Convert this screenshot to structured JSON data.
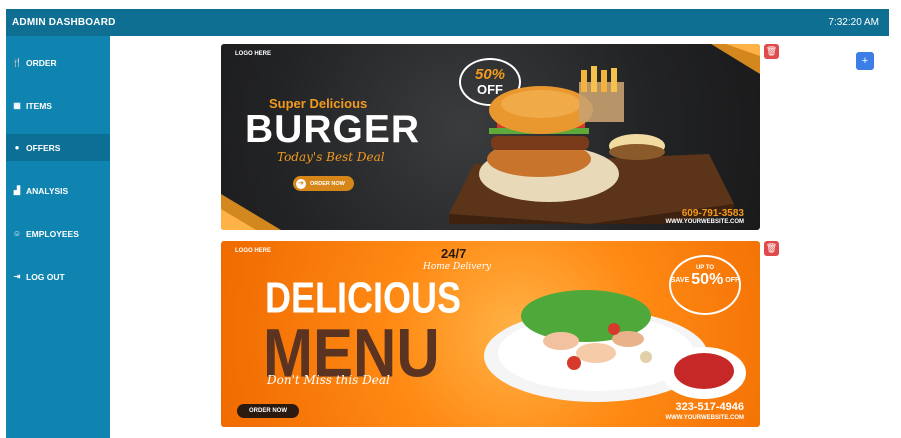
{
  "header": {
    "title": "ADMIN DASHBOARD",
    "clock": "7:32:20 AM"
  },
  "sidebar": {
    "items": [
      {
        "label": "ORDER",
        "icon": "utensils-icon",
        "glyph": "🍴"
      },
      {
        "label": "ITEMS",
        "icon": "items-icon",
        "glyph": "▦"
      },
      {
        "label": "OFFERS",
        "icon": "offer-icon",
        "glyph": "●"
      },
      {
        "label": "ANALYSIS",
        "icon": "chart-icon",
        "glyph": "▟"
      },
      {
        "label": "EMPLOYEES",
        "icon": "people-icon",
        "glyph": "☺"
      },
      {
        "label": "LOG OUT",
        "icon": "logout-icon",
        "glyph": "⇥"
      }
    ],
    "active_index": 2
  },
  "banners": [
    {
      "logo": "LOGO HERE",
      "badge_top": "50%",
      "badge_bottom": "OFF",
      "subtitle": "Super Delicious",
      "title": "BURGER",
      "tagline": "Today's Best Deal",
      "cta": "ORDER NOW",
      "phone": "609-791-3583",
      "website": "WWW.YOURWEBSITE.COM"
    },
    {
      "logo": "LOGO HERE",
      "hours": "24/7",
      "service": "Home Delivery",
      "title_top": "DELICIOUS",
      "title_bottom": "MENU",
      "tagline": "Don't Miss this Deal",
      "badge_upto": "UP TO",
      "badge_save": "SAVE",
      "badge_pct": "50%",
      "badge_off": "OFF",
      "cta": "ORDER NOW",
      "phone": "323-517-4946",
      "website": "WWW.YOURWEBSITE.COM"
    }
  ],
  "actions": {
    "add": "+",
    "delete": "🗑"
  },
  "colors": {
    "topbar": "#0f6f93",
    "sidebar": "#0f84b0",
    "active": "#0c6f95",
    "delete": "#e04a4a",
    "add": "#3b7ee6",
    "burger_accent": "#f39a1e",
    "menu_bg": "#ff8a14"
  }
}
